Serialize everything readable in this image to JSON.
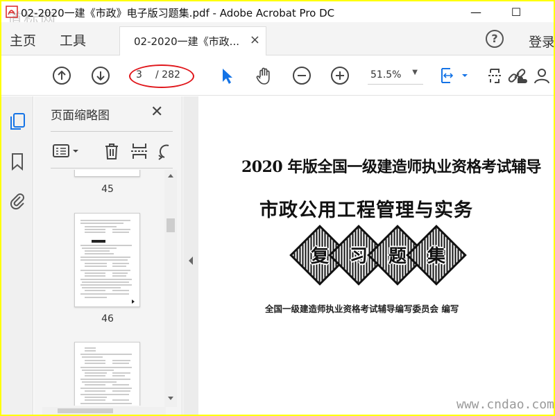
{
  "window": {
    "title": "02-2020一建《市政》电子版习题集.pdf - Adobe Acrobat Pro DC",
    "minimize": "—",
    "maximize": "☐",
    "watermark": "道标网"
  },
  "tabs": {
    "home": "主页",
    "tools": "工具",
    "document": "02-2020一建《市政...",
    "close": "×",
    "help": "?",
    "login": "登录"
  },
  "toolbar": {
    "page_current": "3",
    "page_total": "/ 282",
    "zoom": "51.5%",
    "zoom_caret": "▼",
    "highlight_color": "#e0161b",
    "accent_color": "#1473e6"
  },
  "thumbnail_panel": {
    "title": "页面缩略图",
    "close": "✕",
    "pages": [
      {
        "number": "45"
      },
      {
        "number": "46"
      }
    ]
  },
  "document": {
    "line1": "2020 年版全国一级建造师执业资格考试辅导",
    "line2": "市政公用工程管理与实务",
    "stamps": [
      "复",
      "习",
      "题",
      "集"
    ],
    "line3": "全国一级建造师执业资格考试辅导编写委员会  编写",
    "watermark": "www.cndao.com"
  },
  "icons": {
    "rail": [
      "page-thumbnails-icon",
      "bookmark-icon",
      "attachment-icon"
    ],
    "toolbar": [
      "prev-page-icon",
      "next-page-icon",
      "select-arrow-icon",
      "hand-icon",
      "zoom-out-icon",
      "zoom-in-icon",
      "fit-page-icon",
      "scan-icon",
      "share-link-icon",
      "user-icon"
    ]
  }
}
